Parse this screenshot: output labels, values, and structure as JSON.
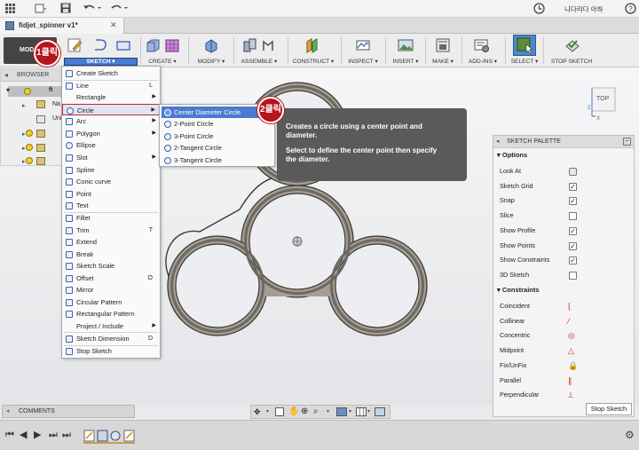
{
  "window": {
    "user_name": "니다리다 아하"
  },
  "document_tab": {
    "title": "fidjet_spinner v1*"
  },
  "ribbon": {
    "model_label": "MODEL",
    "groups": [
      {
        "label": "SKETCH ▾"
      },
      {
        "label": "CREATE ▾"
      },
      {
        "label": "MODIFY ▾"
      },
      {
        "label": "ASSEMBLE ▾"
      },
      {
        "label": "CONSTRUCT ▾"
      },
      {
        "label": "INSPECT ▾"
      },
      {
        "label": "INSERT ▾"
      },
      {
        "label": "MAKE ▾"
      },
      {
        "label": "ADD-INS ▾"
      },
      {
        "label": "SELECT ▾"
      },
      {
        "label": "STOP SKETCH"
      }
    ]
  },
  "browser": {
    "title": "BROWSER",
    "items": [
      {
        "label": "fi"
      },
      {
        "label": "Na"
      },
      {
        "label": "Uni"
      }
    ]
  },
  "sketch_menu": {
    "items": [
      {
        "label": "Create Sketch",
        "shortcut": "",
        "has_submenu": false
      },
      {
        "label": "Line",
        "shortcut": "L",
        "has_submenu": false
      },
      {
        "label": "Rectangle",
        "shortcut": "",
        "has_submenu": true
      },
      {
        "label": "Circle",
        "shortcut": "",
        "has_submenu": true
      },
      {
        "label": "Arc",
        "shortcut": "",
        "has_submenu": true
      },
      {
        "label": "Polygon",
        "shortcut": "",
        "has_submenu": true
      },
      {
        "label": "Ellipse",
        "shortcut": "",
        "has_submenu": false
      },
      {
        "label": "Slot",
        "shortcut": "",
        "has_submenu": true
      },
      {
        "label": "Spline",
        "shortcut": "",
        "has_submenu": false
      },
      {
        "label": "Conic curve",
        "shortcut": "",
        "has_submenu": false
      },
      {
        "label": "Point",
        "shortcut": "",
        "has_submenu": false
      },
      {
        "label": "Text",
        "shortcut": "",
        "has_submenu": false
      },
      {
        "label": "Fillet",
        "shortcut": "",
        "has_submenu": false
      },
      {
        "label": "Trim",
        "shortcut": "T",
        "has_submenu": false
      },
      {
        "label": "Extend",
        "shortcut": "",
        "has_submenu": false
      },
      {
        "label": "Break",
        "shortcut": "",
        "has_submenu": false
      },
      {
        "label": "Sketch Scale",
        "shortcut": "",
        "has_submenu": false
      },
      {
        "label": "Offset",
        "shortcut": "O",
        "has_submenu": false
      },
      {
        "label": "Mirror",
        "shortcut": "",
        "has_submenu": false
      },
      {
        "label": "Circular Pattern",
        "shortcut": "",
        "has_submenu": false
      },
      {
        "label": "Rectangular Pattern",
        "shortcut": "",
        "has_submenu": false
      },
      {
        "label": "Project / Include",
        "shortcut": "",
        "has_submenu": true
      },
      {
        "label": "Sketch Dimension",
        "shortcut": "D",
        "has_submenu": false
      },
      {
        "label": "Stop Sketch",
        "shortcut": "",
        "has_submenu": false
      }
    ]
  },
  "circle_submenu": {
    "items": [
      {
        "label": "Center Diameter Circle",
        "shortcut": "C"
      },
      {
        "label": "2-Point Circle",
        "shortcut": ""
      },
      {
        "label": "3-Point Circle",
        "shortcut": ""
      },
      {
        "label": "2-Tangent Circle",
        "shortcut": ""
      },
      {
        "label": "3-Tangent Circle",
        "shortcut": ""
      }
    ]
  },
  "tooltip": {
    "line1": "Creates a circle using a center point and",
    "line2": "diameter.",
    "line3": "Select to define the center point then specify",
    "line4": "the diameter."
  },
  "annotations": {
    "step1": "1클릭",
    "step2": "2클릭"
  },
  "viewcube": {
    "face_label": "TOP",
    "axis_x": "X",
    "axis_z": "Z"
  },
  "sketch_palette": {
    "title": "SKETCH PALETTE",
    "options_header": "Options",
    "options": [
      {
        "label": "Look At",
        "type": "icon",
        "checked": false
      },
      {
        "label": "Sketch Grid",
        "type": "checkbox",
        "checked": true
      },
      {
        "label": "Snap",
        "type": "checkbox",
        "checked": true
      },
      {
        "label": "Slice",
        "type": "checkbox",
        "checked": false
      },
      {
        "label": "Show Profile",
        "type": "checkbox",
        "checked": true
      },
      {
        "label": "Show Points",
        "type": "checkbox",
        "checked": true
      },
      {
        "label": "Show Constraints",
        "type": "checkbox",
        "checked": true
      },
      {
        "label": "3D Sketch",
        "type": "checkbox",
        "checked": false
      }
    ],
    "constraints_header": "Constraints",
    "constraints": [
      {
        "label": "Coincident",
        "icon": "coincident-icon"
      },
      {
        "label": "Collinear",
        "icon": "collinear-icon"
      },
      {
        "label": "Concentric",
        "icon": "concentric-icon"
      },
      {
        "label": "Midpoint",
        "icon": "midpoint-icon"
      },
      {
        "label": "Fix/UnFix",
        "icon": "lock-icon"
      },
      {
        "label": "Parallel",
        "icon": "parallel-icon"
      },
      {
        "label": "Perpendicular",
        "icon": "perpendicular-icon"
      }
    ],
    "stop_button": "Stop Sketch"
  },
  "comments": {
    "label": "COMMENTS"
  },
  "colors": {
    "highlight": "#4a7bd1",
    "annotation_red": "#b5161b",
    "ribbon_bg": "#ededed"
  }
}
